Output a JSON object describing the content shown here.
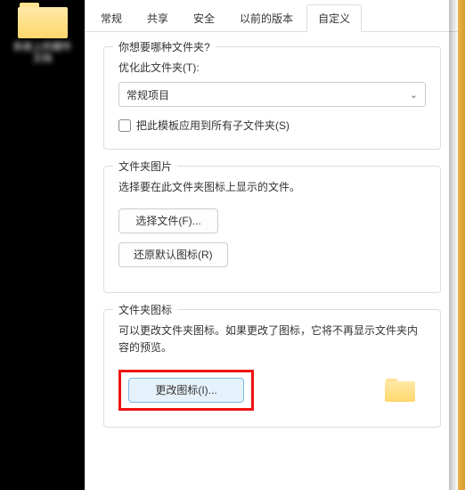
{
  "desktop": {
    "icon_label": "系统上的硬件\n文档"
  },
  "tabs": [
    {
      "label": "常规"
    },
    {
      "label": "共享"
    },
    {
      "label": "安全"
    },
    {
      "label": "以前的版本"
    },
    {
      "label": "自定义",
      "active": true
    }
  ],
  "group1": {
    "title": "你想要哪种文件夹?",
    "optimize_label": "优化此文件夹(T):",
    "select_value": "常规项目",
    "checkbox_label": "把此模板应用到所有子文件夹(S)"
  },
  "group2": {
    "title": "文件夹图片",
    "desc": "选择要在此文件夹图标上显示的文件。",
    "choose_btn": "选择文件(F)...",
    "restore_btn": "还原默认图标(R)"
  },
  "group3": {
    "title": "文件夹图标",
    "desc": "可以更改文件夹图标。如果更改了图标，它将不再显示文件夹内容的预览。",
    "change_btn": "更改图标(I)..."
  }
}
